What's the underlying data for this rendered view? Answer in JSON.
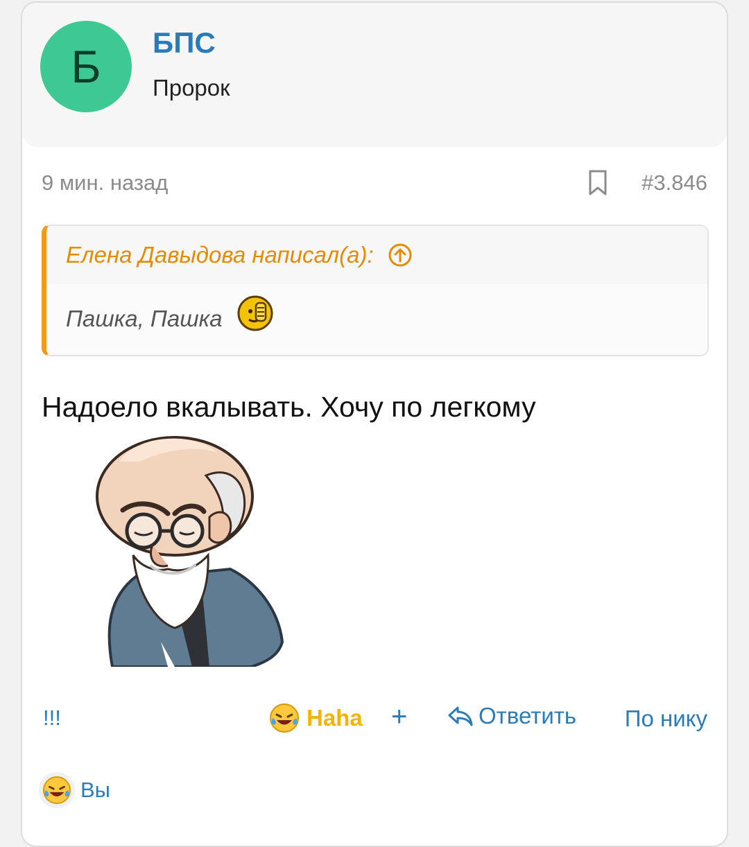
{
  "post": {
    "author": {
      "avatar_letter": "Б",
      "name": "БПС",
      "title": "Пророк"
    },
    "time": "9 мин. назад",
    "number": "#3.846",
    "quote": {
      "author_line": "Елена Давыдова написал(а):",
      "text": "Пашка, Пашка"
    },
    "message": "Надоело вкалывать. Хочу по легкому"
  },
  "actions": {
    "exclaim": "!!!",
    "reaction_label": "Haha",
    "add": "+",
    "reply": "Ответить",
    "by_nick": "По нику"
  },
  "reactions": {
    "you_label": "Вы"
  },
  "colors": {
    "accent": "#2b7bb9",
    "avatar_bg": "#3ec893",
    "quote_accent": "#f29a1a",
    "reaction": "#f4b400"
  }
}
